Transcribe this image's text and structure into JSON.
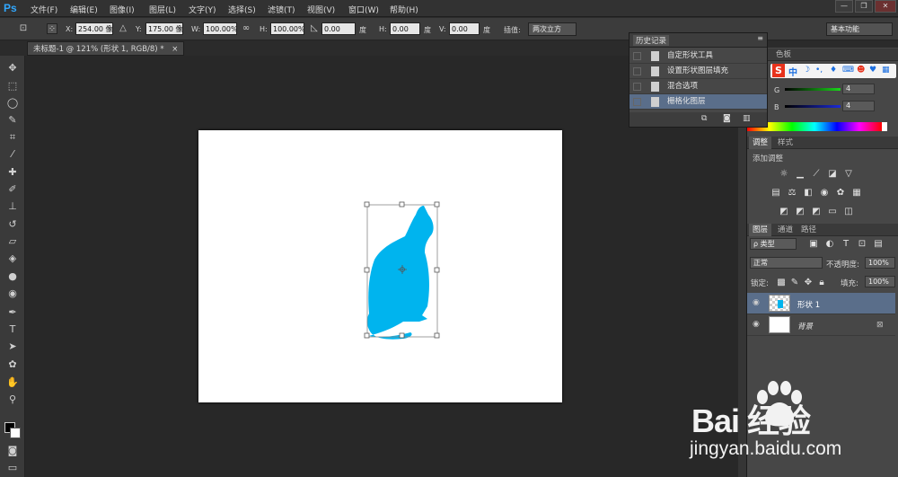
{
  "app": {
    "logo": "Ps",
    "menu": [
      "文件(F)",
      "编辑(E)",
      "图像(I)",
      "图层(L)",
      "文字(Y)",
      "选择(S)",
      "滤镜(T)",
      "视图(V)",
      "窗口(W)",
      "帮助(H)"
    ],
    "window_buttons": [
      "—",
      "❐",
      "✕"
    ]
  },
  "options_bar": {
    "x_label": "X:",
    "x_value": "254.00 像素",
    "y_label": "Y:",
    "y_value": "175.00 像素",
    "w_label": "W:",
    "w_value": "100.00%",
    "h_label": "H:",
    "h_value": "100.00%",
    "angle_value": "0.00",
    "degree": "度",
    "hskew_label": "H:",
    "hskew_value": "0.00",
    "vskew_label": "V:",
    "vskew_value": "0.00",
    "degree2": "度",
    "degree3": "度",
    "interp_label": "插值:",
    "interp_value": "两次立方",
    "workspace": "基本功能"
  },
  "document": {
    "tab_title": "未标题-1 @ 121% (形状 1, RGB/8) *",
    "tab_close": "×"
  },
  "history": {
    "title": "历史记录",
    "items": [
      "自定形状工具",
      "设置形状图层填充",
      "混合选项",
      "栅格化图层"
    ],
    "selected_index": 3
  },
  "color_panel": {
    "tab": "色板",
    "g_label": "G",
    "g_value": "4",
    "b_label": "B",
    "b_value": "4"
  },
  "ime_bar": {
    "brand": "S",
    "lang": "中"
  },
  "adjustments": {
    "tabs": [
      "调整",
      "样式"
    ],
    "title": "添加调整"
  },
  "layers": {
    "tabs": [
      "图层",
      "通道",
      "路径"
    ],
    "kind_label": "ρ 类型",
    "blend_mode": "正常",
    "opacity_label": "不透明度:",
    "opacity_value": "100%",
    "lock_label": "锁定:",
    "fill_label": "填充:",
    "fill_value": "100%",
    "items": [
      {
        "name": "形状 1",
        "selected": true
      },
      {
        "name": "背景",
        "selected": false
      }
    ]
  },
  "watermark": {
    "text": "Bai   经验",
    "url": "jingyan.baidu.com"
  },
  "colors": {
    "shape_fill": "#00b4ee",
    "accent_blue": "#31a8ff"
  }
}
